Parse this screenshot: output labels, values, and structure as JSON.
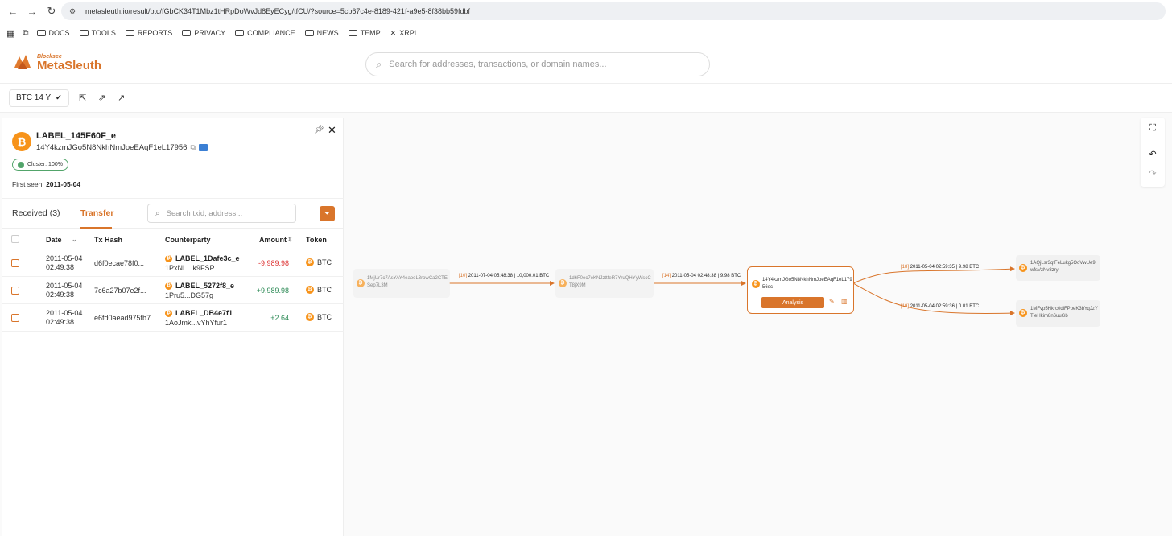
{
  "browser": {
    "url": "metasleuth.io/result/btc/fGbCK34T1Mbz1tHRpDoWvJd8EyECyg/tfCU/?source=5cb67c4e-8189-421f-a9e5-8f38bb59fdbf",
    "bookmarks": [
      "DOCS",
      "TOOLS",
      "REPORTS",
      "PRIVACY",
      "COMPLIANCE",
      "NEWS",
      "TEMP",
      "XRPL"
    ]
  },
  "header": {
    "logo_small": "Blocksec",
    "logo_big": "MetaSleuth",
    "search_placeholder": "Search for addresses, transactions, or domain names..."
  },
  "toolbar": {
    "chain_label": "BTC 14 Y"
  },
  "panel": {
    "label": "LABEL_145F60F_e",
    "address": "14Y4kzmJGo5N8NkhNmJoeEAqF1eL17956",
    "cluster": "Cluster: 100%",
    "first_seen_label": "First seen:",
    "first_seen_value": "2011-05-04",
    "tab_received": "Received (3)",
    "tab_transfer": "Transfer",
    "search_placeholder": "Search txid, address...",
    "columns": {
      "date": "Date",
      "tx_hash": "Tx Hash",
      "counterparty": "Counterparty",
      "amount": "Amount",
      "token": "Token"
    },
    "rows": [
      {
        "date": "2011-05-04",
        "time": "02:49:38",
        "hash": "d6f0ecae78f0...",
        "cp_label": "LABEL_1Dafe3c_e",
        "cp_addr": "1PxNL...k9FSP",
        "amount": "-9,989.98",
        "token": "BTC"
      },
      {
        "date": "2011-05-04",
        "time": "02:49:38",
        "hash": "7c6a27b07e2f...",
        "cp_label": "LABEL_5272f8_e",
        "cp_addr": "1Pru5...DG57g",
        "amount": "+9,989.98",
        "token": "BTC"
      },
      {
        "date": "2011-05-04",
        "time": "02:49:38",
        "hash": "e6fd0aead975fb7...",
        "cp_label": "LABEL_DB4e7f1",
        "cp_addr": "1AoJmk...vYhYfur1",
        "amount": "+2.64",
        "token": "BTC"
      }
    ]
  },
  "graph": {
    "nodes": {
      "n1": "1MjUr7c7AsYAY4eaoeL3rowCa2CTESep7L3M",
      "n2": "1d6F0ec7eKNJzttfeR7YruQHYyWscCT8jX9M",
      "center": "14Y4kzmJGo5N8NkhNmJoeEAqF1eL17956ec",
      "out1": "1AQjLsr3qfFeLukg5OoVwUe9wfsVzNv8zry",
      "out2": "1MFvp5Hkrc0dlFPpeK3bYqJzYTleHkim8n6uuGb"
    },
    "analysis_label": "Analysis",
    "edges": [
      {
        "idx": "[10]",
        "text": "2011-07-04 05:48:38 | 10,000.01 BTC"
      },
      {
        "idx": "[14]",
        "text": "2011-05-04 02:48:38 | 9.98 BTC"
      },
      {
        "idx": "[18]",
        "text": "2011-05-04 02:59:35 | 9.98 BTC"
      },
      {
        "idx": "[19]",
        "text": "2011-05-04 02:59:36 | 0.01 BTC"
      }
    ]
  },
  "colors": {
    "accent": "#d9752b",
    "btc": "#f7931a",
    "negative": "#d33333",
    "positive": "#2e8b57"
  }
}
